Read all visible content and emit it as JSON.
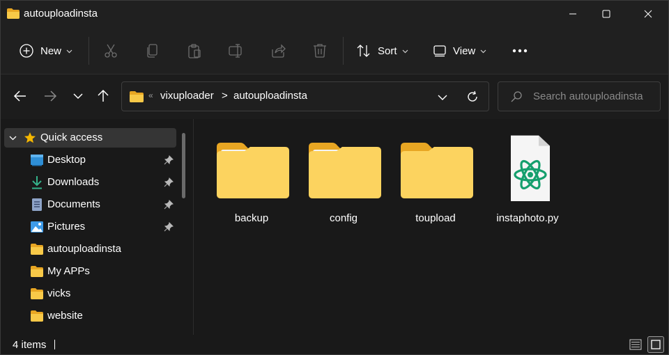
{
  "window": {
    "title": "autouploadinsta"
  },
  "toolbar": {
    "new_label": "New",
    "sort_label": "Sort",
    "view_label": "View"
  },
  "address": {
    "crumbs": [
      "vixuploader",
      "autouploadinsta"
    ],
    "overflow_glyph": "«",
    "separator": ">"
  },
  "search": {
    "placeholder": "Search autouploadinsta"
  },
  "sidebar": {
    "quick_access_label": "Quick access",
    "items": [
      {
        "label": "Desktop",
        "icon": "desktop-icon",
        "pinned": true
      },
      {
        "label": "Downloads",
        "icon": "downloads-icon",
        "pinned": true
      },
      {
        "label": "Documents",
        "icon": "documents-icon",
        "pinned": true
      },
      {
        "label": "Pictures",
        "icon": "pictures-icon",
        "pinned": true
      },
      {
        "label": "autouploadinsta",
        "icon": "folder-icon",
        "pinned": false
      },
      {
        "label": "My APPs",
        "icon": "folder-icon",
        "pinned": false
      },
      {
        "label": "vicks",
        "icon": "folder-icon",
        "pinned": false
      },
      {
        "label": "website",
        "icon": "folder-icon",
        "pinned": false
      }
    ]
  },
  "content": {
    "items": [
      {
        "name": "backup",
        "type": "folder"
      },
      {
        "name": "config",
        "type": "folder"
      },
      {
        "name": "toupload",
        "type": "folder"
      },
      {
        "name": "instaphoto.py",
        "type": "python-file"
      }
    ]
  },
  "status": {
    "item_count": "4 items"
  },
  "colors": {
    "folder_yellow": "#f8c948",
    "folder_light": "#fcdb76",
    "atom_green": "#159f6d",
    "background": "#191919",
    "chrome": "#202020"
  }
}
